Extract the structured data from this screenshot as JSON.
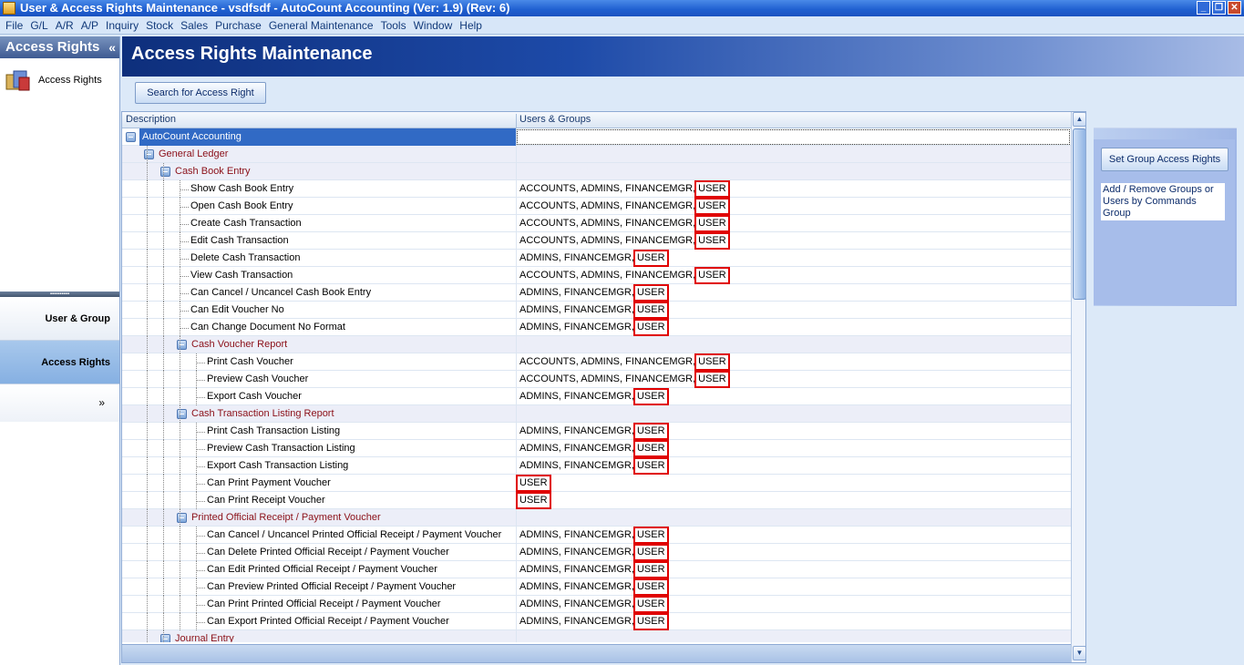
{
  "window": {
    "title": "User & Access Rights Maintenance - vsdfsdf - AutoCount Accounting (Ver: 1.9) (Rev: 6)"
  },
  "menu": [
    "File",
    "G/L",
    "A/R",
    "A/P",
    "Inquiry",
    "Stock",
    "Sales",
    "Purchase",
    "General Maintenance",
    "Tools",
    "Window",
    "Help"
  ],
  "nav": {
    "header": "Access Rights",
    "item": "Access Rights",
    "buttons": [
      "User & Group",
      "Access Rights"
    ],
    "more": "»"
  },
  "page": {
    "title": "Access Rights Maintenance",
    "search_button": "Search for Access Right"
  },
  "grid": {
    "columns": [
      "Description",
      "Users & Groups"
    ],
    "rows": [
      {
        "label": "AutoCount Accounting",
        "users": "",
        "level": 0,
        "kind": "root"
      },
      {
        "label": "General Ledger",
        "users": "",
        "level": 1,
        "kind": "group"
      },
      {
        "label": "Cash Book Entry",
        "users": "",
        "level": 2,
        "kind": "group"
      },
      {
        "label": "Show Cash Book Entry",
        "users": "ACCOUNTS, ADMINS, FINANCEMGR, USER",
        "level": 3,
        "kind": "item"
      },
      {
        "label": "Open Cash Book Entry",
        "users": "ACCOUNTS, ADMINS, FINANCEMGR, USER",
        "level": 3,
        "kind": "item"
      },
      {
        "label": "Create Cash Transaction",
        "users": "ACCOUNTS, ADMINS, FINANCEMGR, USER",
        "level": 3,
        "kind": "item"
      },
      {
        "label": "Edit Cash Transaction",
        "users": "ACCOUNTS, ADMINS, FINANCEMGR, USER",
        "level": 3,
        "kind": "item"
      },
      {
        "label": "Delete Cash Transaction",
        "users": "ADMINS, FINANCEMGR, USER",
        "level": 3,
        "kind": "item"
      },
      {
        "label": "View Cash Transaction",
        "users": "ACCOUNTS, ADMINS, FINANCEMGR, USER",
        "level": 3,
        "kind": "item"
      },
      {
        "label": "Can Cancel / Uncancel Cash Book Entry",
        "users": "ADMINS, FINANCEMGR, USER",
        "level": 3,
        "kind": "item"
      },
      {
        "label": "Can Edit Voucher No",
        "users": "ADMINS, FINANCEMGR, USER",
        "level": 3,
        "kind": "item"
      },
      {
        "label": "Can Change Document No Format",
        "users": "ADMINS, FINANCEMGR, USER",
        "level": 3,
        "kind": "item"
      },
      {
        "label": "Cash Voucher Report",
        "users": "",
        "level": 3,
        "kind": "group"
      },
      {
        "label": "Print Cash Voucher",
        "users": "ACCOUNTS, ADMINS, FINANCEMGR, USER",
        "level": 4,
        "kind": "item"
      },
      {
        "label": "Preview Cash Voucher",
        "users": "ACCOUNTS, ADMINS, FINANCEMGR, USER",
        "level": 4,
        "kind": "item"
      },
      {
        "label": "Export Cash Voucher",
        "users": "ADMINS, FINANCEMGR, USER",
        "level": 4,
        "kind": "item"
      },
      {
        "label": "Cash Transaction Listing Report",
        "users": "",
        "level": 3,
        "kind": "group"
      },
      {
        "label": "Print Cash Transaction Listing",
        "users": "ADMINS, FINANCEMGR, USER",
        "level": 4,
        "kind": "item"
      },
      {
        "label": "Preview Cash Transaction Listing",
        "users": "ADMINS, FINANCEMGR, USER",
        "level": 4,
        "kind": "item"
      },
      {
        "label": "Export Cash Transaction Listing",
        "users": "ADMINS, FINANCEMGR, USER",
        "level": 4,
        "kind": "item"
      },
      {
        "label": "Can Print Payment Voucher",
        "users": "USER",
        "level": 4,
        "kind": "item"
      },
      {
        "label": "Can Print Receipt Voucher",
        "users": "USER",
        "level": 4,
        "kind": "item"
      },
      {
        "label": "Printed Official Receipt / Payment Voucher",
        "users": "",
        "level": 3,
        "kind": "group"
      },
      {
        "label": "Can Cancel / Uncancel Printed Official Receipt / Payment Voucher",
        "users": "ADMINS, FINANCEMGR, USER",
        "level": 4,
        "kind": "item"
      },
      {
        "label": "Can Delete Printed Official Receipt / Payment Voucher",
        "users": "ADMINS, FINANCEMGR, USER",
        "level": 4,
        "kind": "item"
      },
      {
        "label": "Can Edit Printed Official Receipt / Payment Voucher",
        "users": "ADMINS, FINANCEMGR, USER",
        "level": 4,
        "kind": "item"
      },
      {
        "label": "Can Preview Printed Official Receipt / Payment Voucher",
        "users": "ADMINS, FINANCEMGR, USER",
        "level": 4,
        "kind": "item"
      },
      {
        "label": "Can Print Printed Official Receipt / Payment Voucher",
        "users": "ADMINS, FINANCEMGR, USER",
        "level": 4,
        "kind": "item"
      },
      {
        "label": "Can Export Printed Official Receipt / Payment Voucher",
        "users": "ADMINS, FINANCEMGR, USER",
        "level": 4,
        "kind": "item"
      },
      {
        "label": "Journal Entry",
        "users": "",
        "level": 2,
        "kind": "group"
      }
    ]
  },
  "right_panel": {
    "button": "Set Group Access Rights",
    "note": "Add / Remove Groups or Users by Commands Group"
  },
  "colors": {
    "highlight": "#e00000",
    "selection": "#316ac5",
    "group_text": "#8b1018"
  }
}
